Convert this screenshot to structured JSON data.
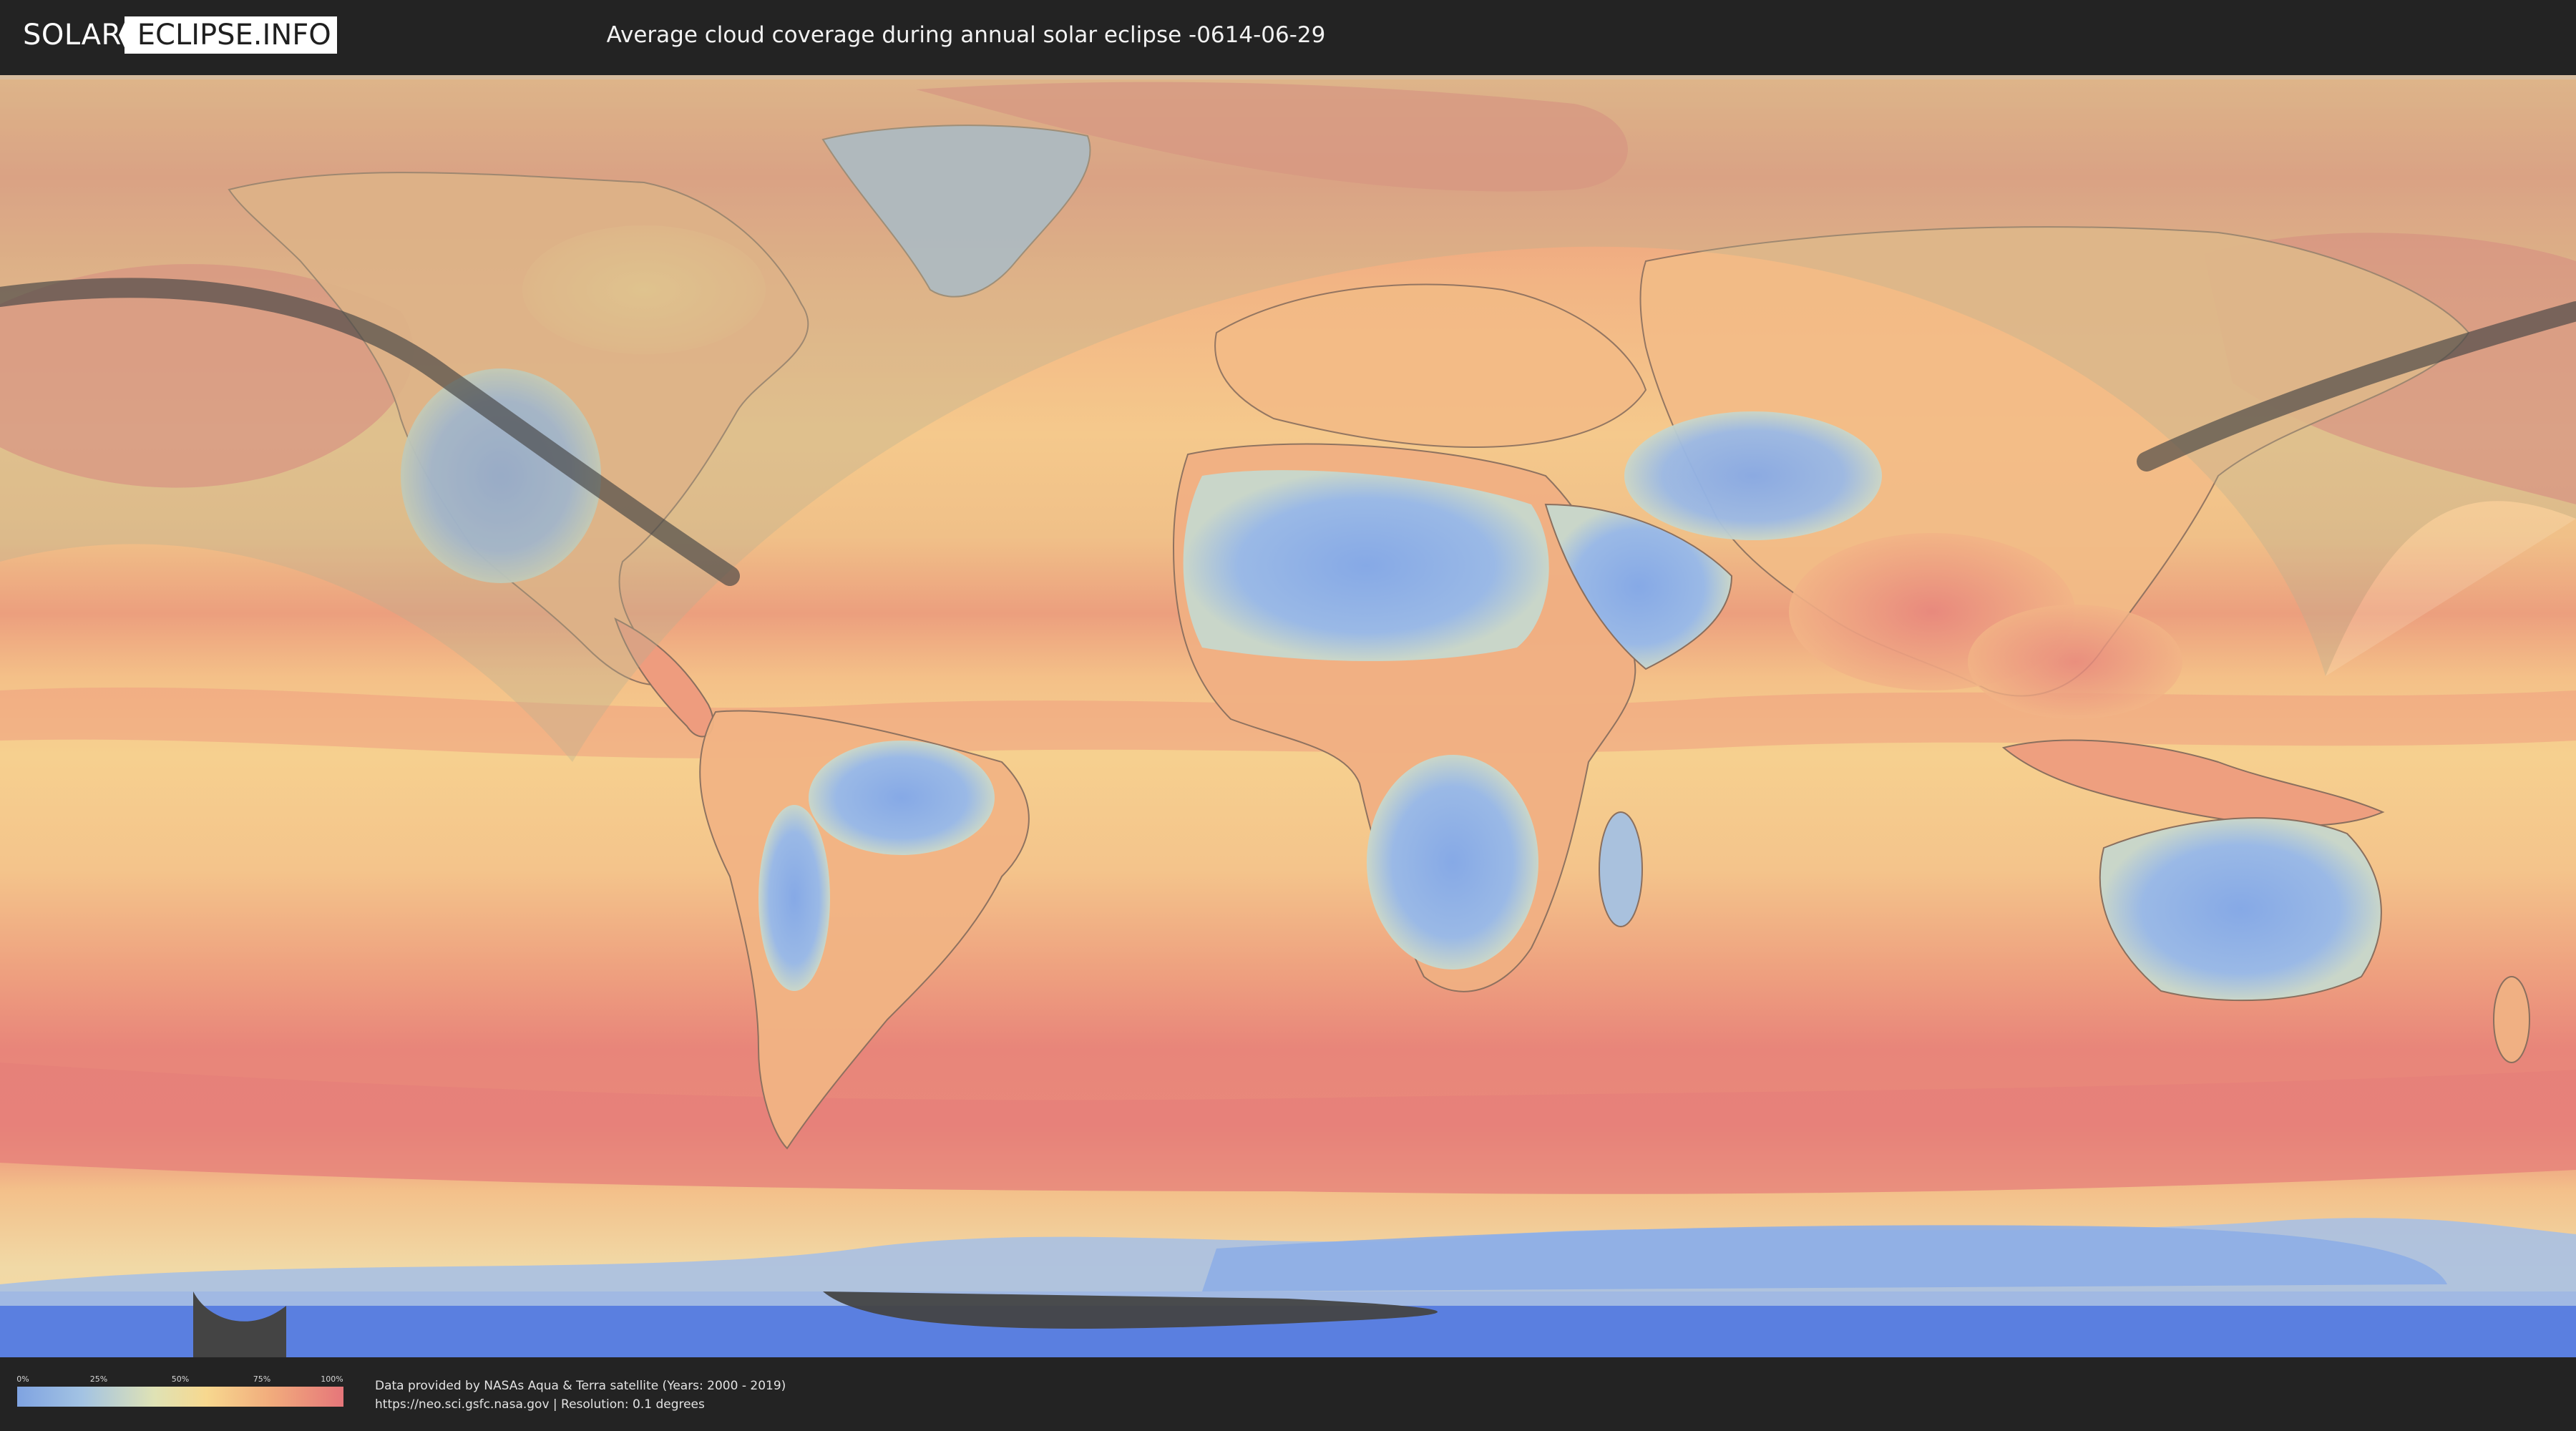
{
  "header": {
    "logo_left": "SOLAR",
    "logo_right": "ECLIPSE.INFO",
    "title": "Average cloud coverage during annual solar eclipse -0614-06-29"
  },
  "legend": {
    "ticks": [
      "0%",
      "25%",
      "50%",
      "75%",
      "100%"
    ],
    "scale_colors": [
      "#7fa3e1",
      "#a3c3e3",
      "#dfe2b5",
      "#f7d88f",
      "#f1ab7c",
      "#e6767a"
    ]
  },
  "footer": {
    "credit_line1": "Data provided by NASAs Aqua & Terra satellite (Years: 2000 - 2019)",
    "credit_line2": "https://neo.sci.gsfc.nasa.gov | Resolution: 0.1 degrees"
  },
  "colors": {
    "background": "#232323",
    "ocean_cloudy": "#e9857a",
    "ocean_mid": "#f5c98e",
    "clear_land": "#8fb0e6",
    "antarctic_ice": "#5a7fe0",
    "eclipse_path": "#444444"
  },
  "map": {
    "projection": "equirectangular",
    "legend_scale": "cloud coverage 0% to 100%"
  }
}
